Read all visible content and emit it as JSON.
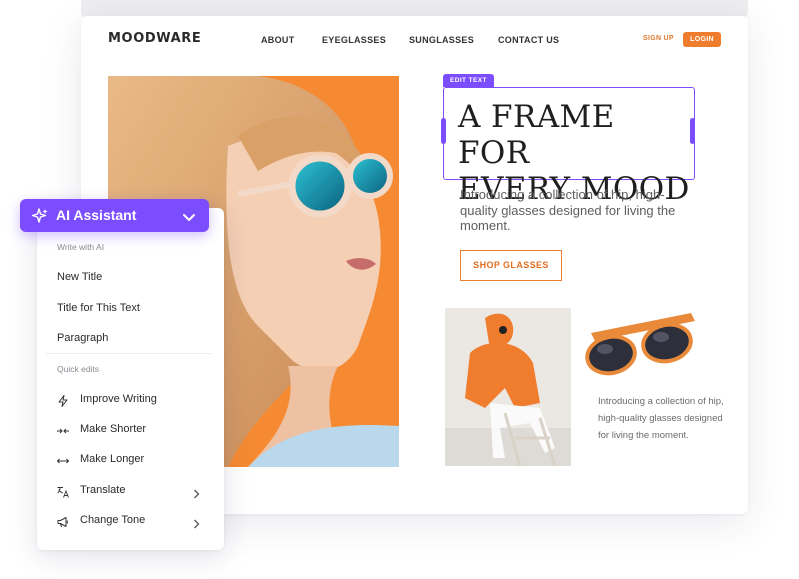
{
  "site": {
    "logo": "MOODWARE",
    "nav": [
      "ABOUT",
      "EYEGLASSES",
      "SUNGLASSES",
      "CONTACT US"
    ],
    "signup": "SIGN UP",
    "login": "LOGIN"
  },
  "hero": {
    "edit_tag": "EDIT TEXT",
    "headline_line1": "A FRAME FOR",
    "headline_line2": "EVERY MOOD",
    "intro": "Introducing a collection of hip, high-quality glasses designed for living the moment.",
    "cta": "SHOP GLASSES"
  },
  "product": {
    "description": "Introducing a collection of hip, high-quality glasses designed for living the moment."
  },
  "ai_assistant": {
    "title": "AI Assistant",
    "section_write": "Write with AI",
    "write_items": [
      "New Title",
      "Title for This Text",
      "Paragraph"
    ],
    "section_quick": "Quick edits",
    "quick_items": [
      {
        "label": "Improve Writing",
        "icon": "lightning-icon",
        "has_submenu": false
      },
      {
        "label": "Make Shorter",
        "icon": "compress-arrows-icon",
        "has_submenu": false
      },
      {
        "label": "Make Longer",
        "icon": "expand-arrows-icon",
        "has_submenu": false
      },
      {
        "label": "Translate",
        "icon": "translate-icon",
        "has_submenu": true
      },
      {
        "label": "Change Tone",
        "icon": "megaphone-icon",
        "has_submenu": true
      }
    ]
  },
  "colors": {
    "accent_purple": "#7c4dff",
    "brand_orange": "#f07c2e",
    "hero_background": "#f58a33"
  }
}
